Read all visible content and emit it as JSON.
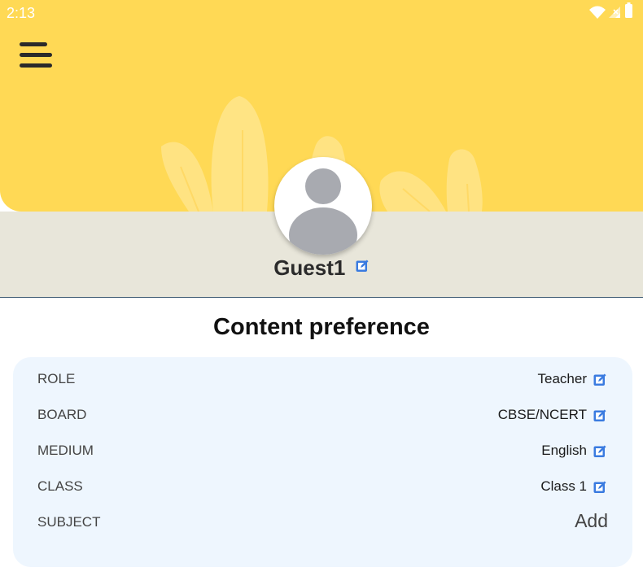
{
  "status_bar": {
    "time": "2:13",
    "icons": [
      "wifi-icon",
      "signal-icon",
      "battery-icon"
    ]
  },
  "header": {
    "menu_icon": "hamburger-menu-icon",
    "background_color": "#ffd955"
  },
  "profile": {
    "name": "Guest1",
    "avatar_icon": "user-avatar-icon",
    "edit_icon": "edit-icon"
  },
  "content_preference": {
    "title": "Content preference",
    "rows": [
      {
        "label": "ROLE",
        "value": "Teacher",
        "action": "edit"
      },
      {
        "label": "BOARD",
        "value": "CBSE/NCERT",
        "action": "edit"
      },
      {
        "label": "MEDIUM",
        "value": "English",
        "action": "edit"
      },
      {
        "label": "CLASS",
        "value": "Class 1",
        "action": "edit"
      },
      {
        "label": "SUBJECT",
        "value": "",
        "action_label": "Add"
      }
    ]
  },
  "colors": {
    "accent_blue": "#3a7be0",
    "card_background": "#eef6fe",
    "band_background": "#e8e6da"
  }
}
